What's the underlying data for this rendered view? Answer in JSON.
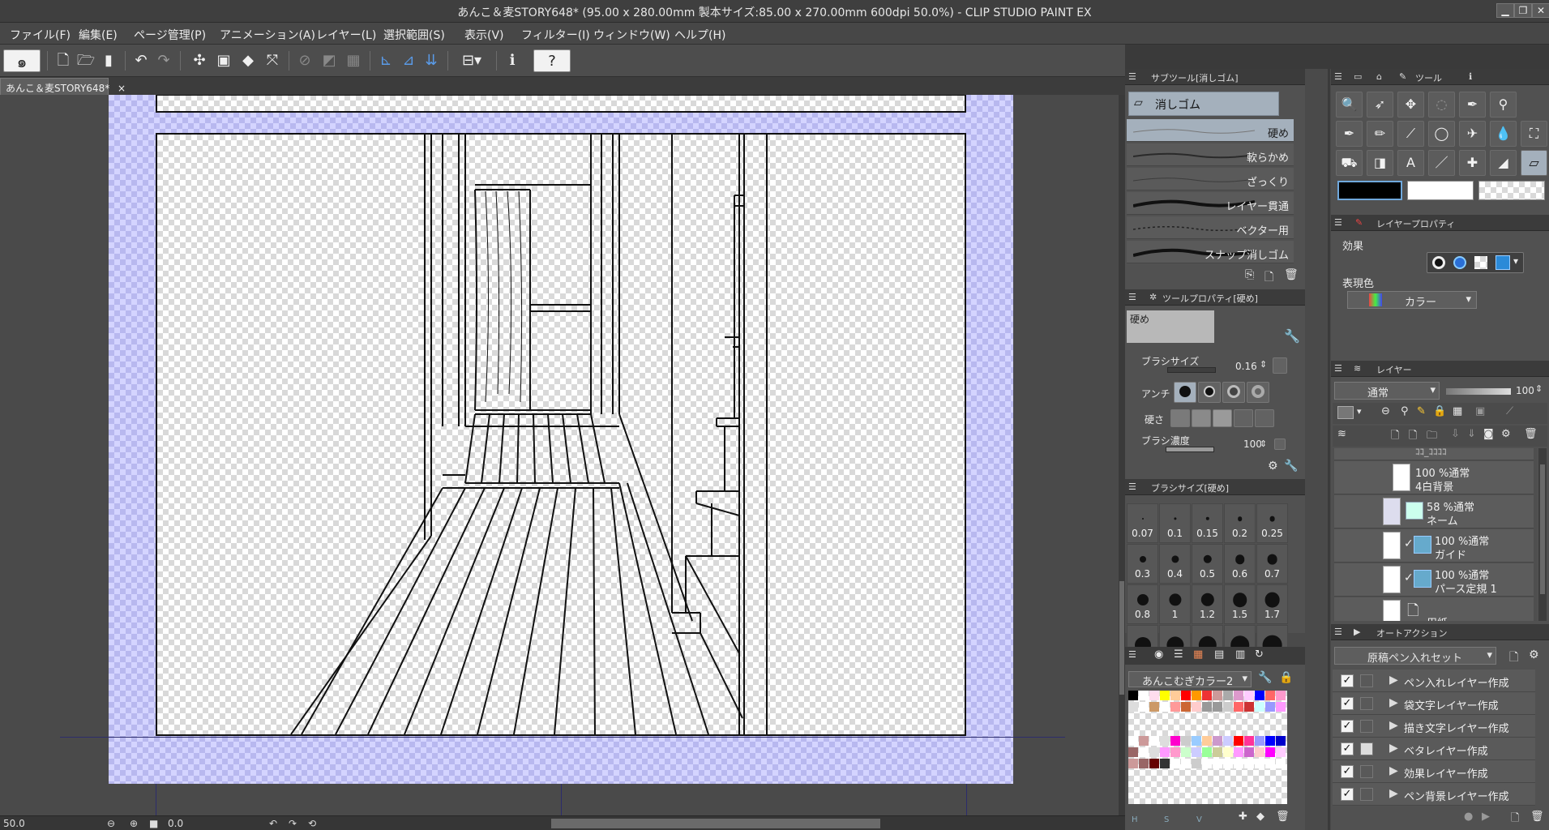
{
  "window": {
    "title": "あんこ＆麦STORY648* (95.00 x 280.00mm 製本サイズ:85.00 x 270.00mm 600dpi 50.0%)  - CLIP STUDIO PAINT EX"
  },
  "menu": [
    "ファイル(F)",
    "編集(E)",
    "ページ管理(P)",
    "アニメーション(A)",
    "レイヤー(L)",
    "選択範囲(S)",
    "表示(V)",
    "フィルター(I)",
    "ウィンドウ(W)",
    "ヘルプ(H)"
  ],
  "document_tab": {
    "label": "あんこ＆麦STORY648*",
    "close": "×"
  },
  "status": {
    "zoom": "50.0",
    "angle": "0.0"
  },
  "subtool": {
    "panel_title": "サブツール[消しゴム]",
    "group": "消しゴム",
    "items": [
      "硬め",
      "軟らかめ",
      "ざっくり",
      "レイヤー貫通",
      "ベクター用",
      "スナップ消しゴム"
    ]
  },
  "tool_property": {
    "panel_title": "ツールプロパティ[硬め]",
    "preview_label": "硬め",
    "brush_size_label": "ブラシサイズ",
    "brush_size_value": "0.16",
    "anti_label": "アンチ",
    "hardness_label": "硬さ",
    "density_label": "ブラシ濃度",
    "density_value": "100"
  },
  "brush_size": {
    "panel_title": "ブラシサイズ[硬め]",
    "values": [
      "0.07",
      "0.1",
      "0.15",
      "0.2",
      "0.25",
      "0.3",
      "0.4",
      "0.5",
      "0.6",
      "0.7",
      "0.8",
      "1",
      "1.2",
      "1.5",
      "1.7",
      "",
      "",
      "",
      "",
      ""
    ]
  },
  "color_set": {
    "name": "あんこむぎカラー2",
    "footer": [
      "H",
      "S",
      "V"
    ]
  },
  "tool_palette": {
    "panel_title": "ツール"
  },
  "layer_property": {
    "panel_title": "レイヤープロパティ",
    "effect_label": "効果",
    "expression_label": "表現色",
    "expression_value": "カラー"
  },
  "layer_panel": {
    "panel_title": "レイヤー",
    "blend_mode": "通常",
    "opacity": "100",
    "partial_top": "ｺｺ_ｺｺｺｺ",
    "layers": [
      {
        "l1": "100 %通常",
        "l2": "4白背景"
      },
      {
        "l1": "58 %通常",
        "l2": "ネーム"
      },
      {
        "l1": "100 %通常",
        "l2": "ガイド"
      },
      {
        "l1": "100 %通常",
        "l2": "パース定規 1"
      },
      {
        "l1": "",
        "l2": "用紙"
      }
    ]
  },
  "auto_action": {
    "panel_title": "オートアクション",
    "set": "原稿ペン入れセット",
    "items": [
      "ペン入れレイヤー作成",
      "袋文字レイヤー作成",
      "描き文字レイヤー作成",
      "ベタレイヤー作成",
      "効果レイヤー作成",
      "ペン背景レイヤー作成"
    ]
  },
  "colors": {
    "panel_bg": "#515151",
    "selection": "#a4b0bc",
    "accent_blue": "#5a9be8"
  }
}
